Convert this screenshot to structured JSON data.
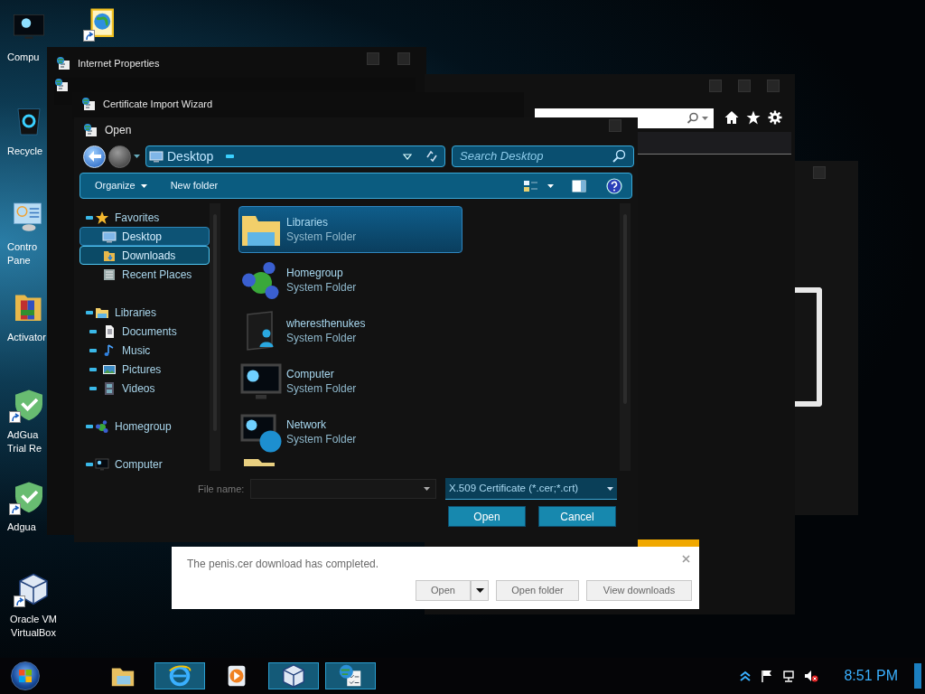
{
  "desktop_icons": [
    {
      "kind": "computer",
      "shortcut": false,
      "lines": [
        "Compu"
      ]
    },
    {
      "kind": "ie_doc",
      "shortcut": true
    },
    {
      "kind": "recycle",
      "shortcut": false,
      "lines": [
        "Recycle"
      ]
    },
    {
      "kind": "control",
      "shortcut": false,
      "lines": [
        "Contro",
        "Pane"
      ]
    },
    {
      "kind": "folder",
      "shortcut": false,
      "lines": [
        "Activator"
      ]
    },
    {
      "kind": "shield",
      "shortcut": true,
      "lines": [
        "AdGua",
        "Trial Re"
      ]
    },
    {
      "kind": "shield",
      "shortcut": true,
      "lines": [
        "Adgua"
      ]
    },
    {
      "kind": "vbox",
      "shortcut": true,
      "lines": [
        "Oracle VM",
        "VirtualBox"
      ]
    }
  ],
  "internet_properties": {
    "title": "Internet Properties"
  },
  "certificate_import_wizard": {
    "title": "Certificate Import Wizard"
  },
  "open_dialog": {
    "title": "Open",
    "address": "Desktop",
    "search": {
      "placeholder": "Search Desktop"
    },
    "toolbar": [
      "Organize",
      "New folder"
    ],
    "nav": [
      {
        "label": "Favorites",
        "kind": "star",
        "selected": false,
        "hovered": false,
        "children": [
          {
            "label": "Desktop",
            "kind": "desktop",
            "selected": true,
            "hovered": false
          },
          {
            "label": "Downloads",
            "kind": "downloads",
            "selected": false,
            "hovered": true
          },
          {
            "label": "Recent Places",
            "kind": "recent",
            "selected": false,
            "hovered": false
          }
        ]
      },
      {
        "label": "Libraries",
        "kind": "library",
        "selected": false,
        "hovered": false,
        "children": [
          {
            "label": "Documents",
            "kind": "documents",
            "selected": false,
            "hovered": false,
            "expandable": true
          },
          {
            "label": "Music",
            "kind": "music",
            "selected": false,
            "hovered": false,
            "expandable": true
          },
          {
            "label": "Pictures",
            "kind": "pictures",
            "selected": false,
            "hovered": false,
            "expandable": true
          },
          {
            "label": "Videos",
            "kind": "videos",
            "selected": false,
            "hovered": false,
            "expandable": true
          }
        ]
      },
      {
        "label": "Homegroup",
        "kind": "homegroup",
        "selected": false,
        "hovered": false
      },
      {
        "label": "Computer",
        "kind": "computer",
        "selected": false,
        "hovered": false
      }
    ],
    "files": [
      {
        "name": "Libraries",
        "type": "System Folder",
        "kind": "library",
        "selected": true
      },
      {
        "name": "Homegroup",
        "type": "System Folder",
        "kind": "homegroup",
        "selected": false
      },
      {
        "name": "wheresthenukes",
        "type": "System Folder",
        "kind": "user",
        "selected": false
      },
      {
        "name": "Computer",
        "type": "System Folder",
        "kind": "computer",
        "selected": false
      },
      {
        "name": "Network",
        "type": "System Folder",
        "kind": "network",
        "selected": false
      }
    ],
    "file_name": {
      "label": "File name:"
    },
    "file_type": "X.509 Certificate (*.cer;*.crt)",
    "buttons": [
      "Open",
      "Cancel"
    ]
  },
  "download_bar": {
    "message": "The penis.cer download has completed.",
    "buttons": [
      "Open",
      "Open folder",
      "View downloads"
    ]
  },
  "taskbar": {
    "apps": [
      {
        "kind": "explorer",
        "running": false
      },
      {
        "kind": "ie",
        "running": true
      },
      {
        "kind": "media",
        "running": false
      },
      {
        "kind": "vbox",
        "running": true
      },
      {
        "kind": "certmgr",
        "running": true
      }
    ],
    "clock": "8:51 PM"
  }
}
